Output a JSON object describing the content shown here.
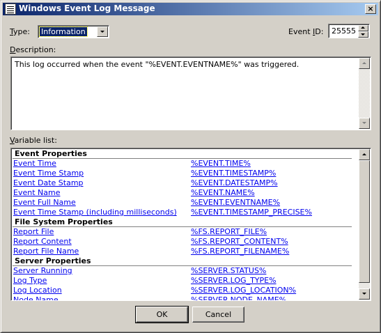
{
  "window": {
    "title": "Windows Event Log Message",
    "close_glyph": "×"
  },
  "type_field": {
    "label": "Type:",
    "label_prefix": "",
    "label_hotkey": "T",
    "label_rest": "ype:",
    "value": "Information"
  },
  "event_id_field": {
    "label": "Event ID:",
    "label_prefix": "Event ",
    "label_hotkey": "I",
    "label_rest": "D:",
    "value": "25555"
  },
  "description": {
    "label": "Description:",
    "label_hotkey": "D",
    "label_rest": "escription:",
    "text": "This log occurred when the event \"%EVENT.EVENTNAME%\" was triggered."
  },
  "variable_list": {
    "label": "Variable list:",
    "label_hotkey": "V",
    "label_rest": "ariable list:",
    "groups": [
      {
        "header": "Event Properties",
        "items": [
          {
            "name": "Event Time",
            "code": "%EVENT.TIME%"
          },
          {
            "name": "Event Time Stamp",
            "code": "%EVENT.TIMESTAMP%"
          },
          {
            "name": "Event Date Stamp",
            "code": "%EVENT.DATESTAMP%"
          },
          {
            "name": "Event Name",
            "code": "%EVENT.NAME%"
          },
          {
            "name": "Event Full Name",
            "code": "%EVENT.EVENTNAME%"
          },
          {
            "name": "Event Time Stamp (including milliseconds)",
            "code": "%EVENT.TIMESTAMP_PRECISE%"
          }
        ]
      },
      {
        "header": "File System Properties",
        "items": [
          {
            "name": "Report File",
            "code": "%FS.REPORT_FILE%"
          },
          {
            "name": "Report Content",
            "code": "%FS.REPORT_CONTENT%"
          },
          {
            "name": "Report File Name",
            "code": "%FS.REPORT_FILENAME%"
          }
        ]
      },
      {
        "header": "Server Properties",
        "items": [
          {
            "name": "Server Running",
            "code": "%SERVER.STATUS%"
          },
          {
            "name": "Log Type",
            "code": "%SERVER.LOG_TYPE%"
          },
          {
            "name": "Log Location",
            "code": "%SERVER.LOG_LOCATION%"
          },
          {
            "name": "Node Name",
            "code": "%SERVER.NODE_NAME%"
          }
        ]
      }
    ]
  },
  "buttons": {
    "ok": "OK",
    "cancel": "Cancel"
  },
  "colors": {
    "dialog_face": "#d4d0c8",
    "titlebar_start": "#0a246a",
    "titlebar_end": "#a6caf0",
    "link": "#0000ee",
    "selection": "#0a246a"
  }
}
